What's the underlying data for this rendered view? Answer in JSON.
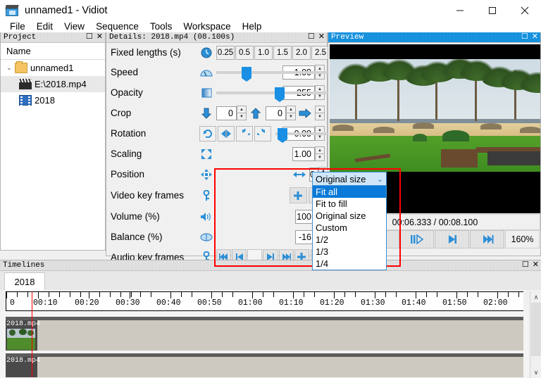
{
  "window": {
    "title": "unnamed1 - Vidiot",
    "app_icon": "clapperboard-icon",
    "minimize": "—",
    "maximize": "☐",
    "close": "✕"
  },
  "menubar": {
    "items": [
      "File",
      "Edit",
      "View",
      "Sequence",
      "Tools",
      "Workspace",
      "Help"
    ]
  },
  "project_pane": {
    "caption": "Project",
    "restore": "☐",
    "close": "✕",
    "column_header": "Name",
    "tree": [
      {
        "label": "unnamed1",
        "icon": "folder-icon",
        "twisty": "⌄",
        "depth": 0
      },
      {
        "label": "E:\\2018.mp4",
        "icon": "clapperboard-icon",
        "twisty": "",
        "depth": 1
      },
      {
        "label": "2018",
        "icon": "film-strip-icon",
        "twisty": "",
        "depth": 1
      }
    ]
  },
  "details_pane": {
    "caption": "Details: 2018.mp4 (08.100s)",
    "restore": "☐",
    "close": "✕",
    "rows": {
      "fixed_lengths": {
        "label": "Fixed lengths (s)",
        "icon": "clock-icon",
        "buttons": [
          "0.25",
          "0.5",
          "1.0",
          "1.5",
          "2.0",
          "2.5"
        ]
      },
      "speed": {
        "label": "Speed",
        "icon": "speedometer-icon",
        "value": "1.00",
        "slider_pct": 40
      },
      "opacity": {
        "label": "Opacity",
        "icon": "opacity-gradient-icon",
        "value": "255",
        "slider_pct": 96
      },
      "crop": {
        "label": "Crop",
        "icon_down": "arrow-down-icon",
        "icon_up": "arrow-up-icon",
        "icon_right": "arrow-right-icon",
        "value_top": "0",
        "value_bottom": "0"
      },
      "rotation": {
        "label": "Rotation",
        "buttons": [
          "rotate-reset-icon",
          "flip-horizontal-icon",
          "rotate-ccw-icon",
          "rotate-cw-icon"
        ],
        "value": "0.00",
        "slider_pct": 70
      },
      "scaling": {
        "label": "Scaling",
        "icon": "scale-icon",
        "selected": "Original size",
        "chevron": "⌄",
        "value": "1.00",
        "options": [
          "Fit all",
          "Fit to fill",
          "Original size",
          "Custom",
          "1/2",
          "1/3",
          "1/4"
        ],
        "highlighted_option": "Fit all"
      },
      "position": {
        "label": "Position",
        "icon": "move-icon",
        "arrow_icon": "arrows-horizontal-icon",
        "value": "0"
      },
      "video_key_frames": {
        "label": "Video key frames",
        "icon": "key-icon",
        "add": "+",
        "remove": "−"
      },
      "volume": {
        "label": "Volume (%)",
        "icon": "speaker-icon",
        "value": "100"
      },
      "balance": {
        "label": "Balance (%)",
        "icon": "balance-icon",
        "value": "-16"
      },
      "audio_key_frames": {
        "label": "Audio key frames",
        "icon": "key-icon",
        "buttons": [
          "skip-start-icon",
          "prev-icon",
          "blank",
          "next-icon",
          "skip-end-icon"
        ],
        "add": "+",
        "remove": "−"
      }
    }
  },
  "preview_pane": {
    "caption": "Preview",
    "restore": "☐",
    "close": "✕",
    "time_display": "00:06.333 / 00:08.100",
    "transport": [
      "skip-to-start-icon",
      "step-back-icon",
      "play-icon",
      "step-forward-icon",
      "skip-to-end-icon"
    ],
    "zoom_level": "160%"
  },
  "timelines_pane": {
    "caption": "Timelines",
    "restore": "☐",
    "close": "✕",
    "tab": "2018",
    "ruler": {
      "labels": [
        "0",
        "00:10",
        "00:20",
        "00:30",
        "00:40",
        "00:50",
        "01:00",
        "01:10",
        "01:20",
        "01:30",
        "01:40",
        "01:50",
        "02:00"
      ]
    },
    "playhead_label": "",
    "tracks": [
      {
        "clip_name": "2018.mp4",
        "has_thumbnail": true
      },
      {
        "clip_name": "2018.mp4",
        "has_thumbnail": false
      }
    ],
    "scroll_up": "∧",
    "scroll_down": "∨"
  },
  "colors": {
    "accent": "#1a93e0",
    "highlight_red": "#ff0000",
    "dropdown_selected": "#0a7ad8",
    "combo_bg": "#cfe6f8"
  }
}
